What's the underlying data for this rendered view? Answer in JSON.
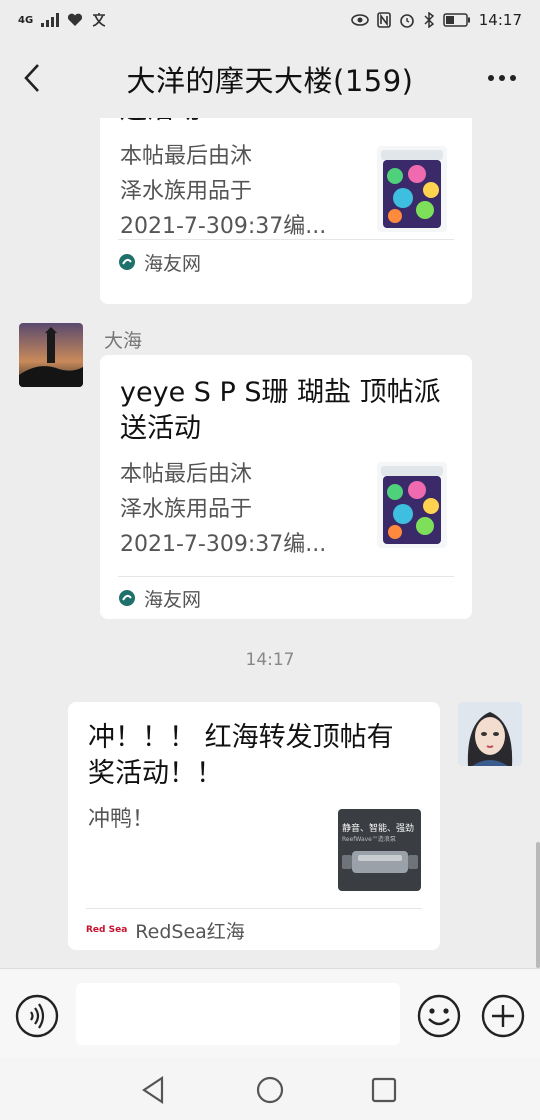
{
  "status_bar": {
    "network": "4G",
    "time": "14:17"
  },
  "header": {
    "title": "大洋的摩天大楼(159)"
  },
  "messages": [
    {
      "card_title_partial": "送活动",
      "card_desc": [
        "本帖最后由沐",
        "泽水族用品于",
        "2021-7-309:37编..."
      ],
      "source": "海友网"
    },
    {
      "sender": "大海",
      "card_title": [
        "yeye S P S珊 瑚盐 顶帖派",
        "送活动"
      ],
      "card_desc": [
        "本帖最后由沐",
        "泽水族用品于",
        "2021-7-309:37编..."
      ],
      "source": "海友网"
    },
    {
      "timestamp": "14:17"
    },
    {
      "card_title": [
        "冲！！！ 红海转发顶帖有",
        "奖活动！！"
      ],
      "card_desc": "冲鸭！",
      "thumb_text": "静音、智能、强劲",
      "thumb_sub": "ReefWave™造浪泵",
      "source_logo": "Red Sea",
      "source": "RedSea红海"
    }
  ],
  "input_bar": {
    "placeholder": ""
  },
  "icons": {
    "back": "chevron-left-icon",
    "more": "more-dots-icon",
    "voice": "voice-icon",
    "emoji": "emoji-icon",
    "plus": "plus-icon"
  }
}
